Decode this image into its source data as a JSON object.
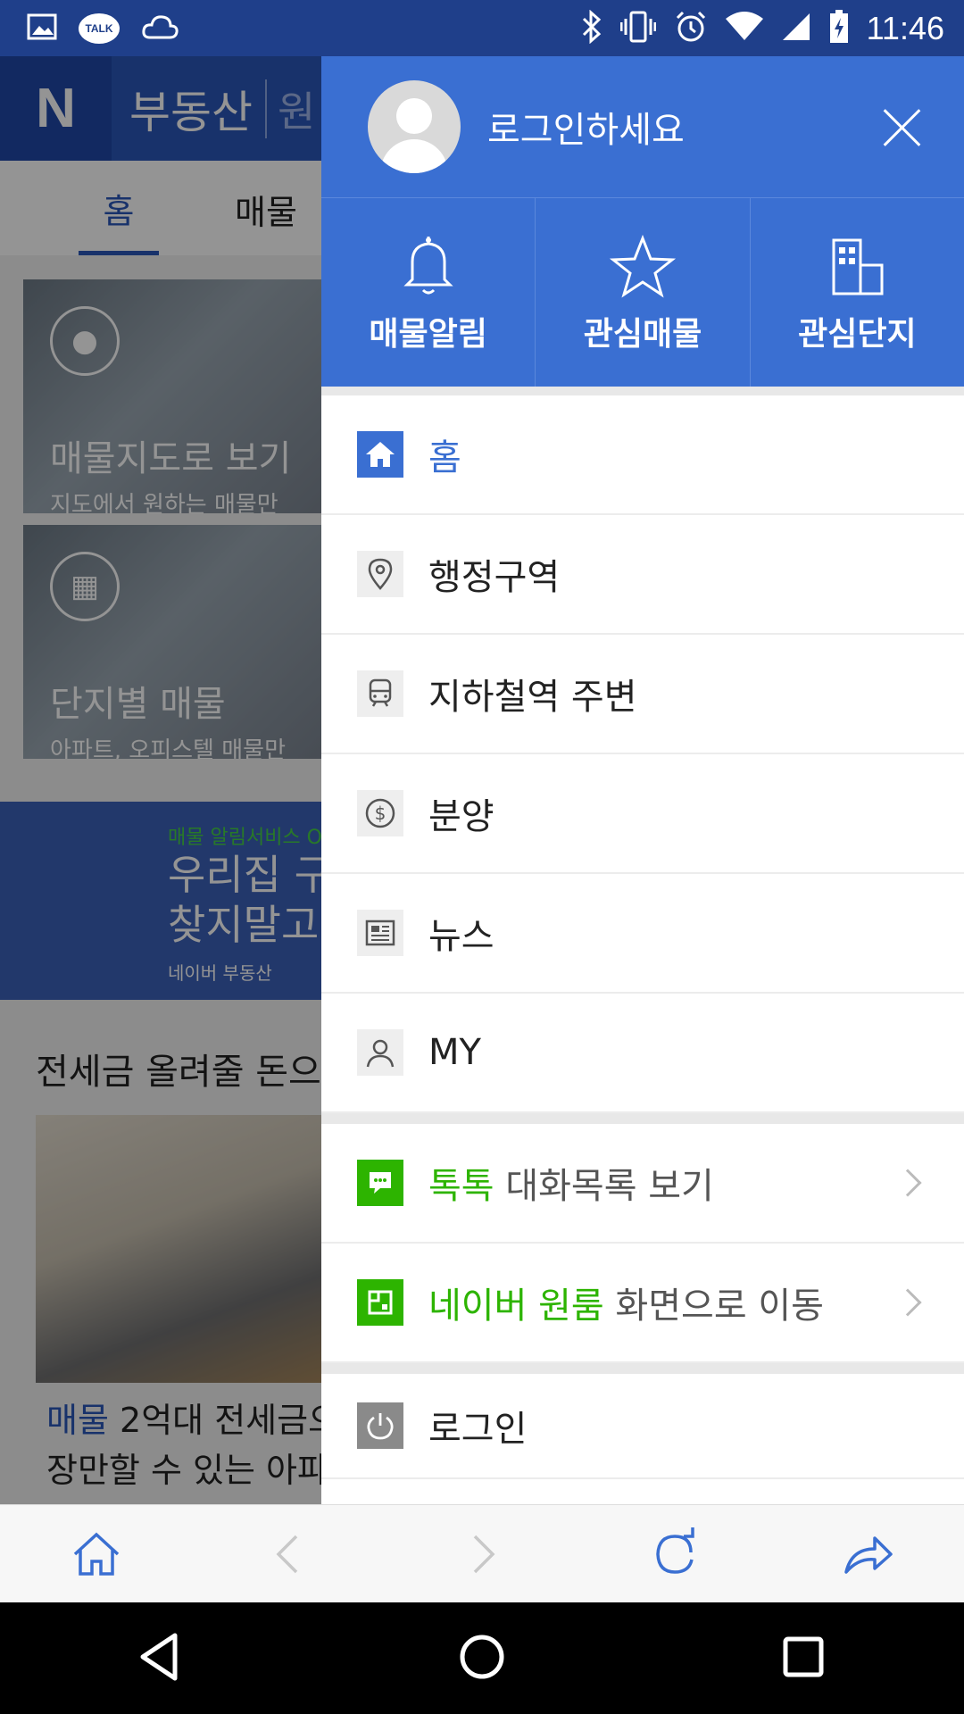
{
  "status_bar": {
    "time": "11:46",
    "left_icons": [
      "gallery-icon",
      "kakaotalk-icon",
      "weather-icon"
    ],
    "talk_label": "TALK",
    "right_icons": [
      "bluetooth-icon",
      "vibrate-icon",
      "alarm-icon",
      "wifi-icon",
      "signal-icon",
      "battery-icon"
    ]
  },
  "background_page": {
    "logo": "N",
    "title": "부동산",
    "subtitle": "원",
    "tabs": [
      "홈",
      "매물"
    ],
    "cards": [
      {
        "title": "매물지도로 보기",
        "subtitle": "지도에서 원하는 매물만 "
      },
      {
        "title": "단지별 매물",
        "subtitle": "아파트, 오피스텔 매물만"
      }
    ],
    "banner": {
      "small": "매물 알림서비스 O",
      "line1": "우리집 구하",
      "line2": "찾지말고 ",
      "brand": "네이버 부동산"
    },
    "article_title": "전세금 올려줄 돈으",
    "article_caption": {
      "tag": "매물",
      "line1": "2억대 전세금으",
      "line2": "장만할 수 있는 아파트"
    }
  },
  "drawer": {
    "login_prompt": "로그인하세요",
    "quick_actions": [
      {
        "label": "매물알림",
        "icon": "bell-icon"
      },
      {
        "label": "관심매물",
        "icon": "star-icon"
      },
      {
        "label": "관심단지",
        "icon": "building-icon"
      }
    ],
    "menu": [
      {
        "label": "홈",
        "icon": "home-icon",
        "active": true
      },
      {
        "label": "행정구역",
        "icon": "location-pin-icon"
      },
      {
        "label": "지하철역 주변",
        "icon": "subway-icon"
      },
      {
        "label": "분양",
        "icon": "dollar-icon"
      },
      {
        "label": "뉴스",
        "icon": "news-icon"
      },
      {
        "label": "MY",
        "icon": "person-icon"
      }
    ],
    "links": [
      {
        "highlight": "톡톡",
        "rest": " 대화목록 보기",
        "icon": "chat-icon"
      },
      {
        "highlight": "네이버 원룸",
        "rest": " 화면으로 이동",
        "icon": "oneroom-icon"
      }
    ],
    "login": {
      "label": "로그인",
      "icon": "power-icon"
    }
  },
  "browser_bar": {
    "buttons": [
      "home-icon",
      "back-icon",
      "forward-icon",
      "refresh-icon",
      "share-icon"
    ]
  },
  "colors": {
    "primary": "#3a6fd2",
    "green": "#2db400",
    "status_bar": "#1f3f8a"
  }
}
